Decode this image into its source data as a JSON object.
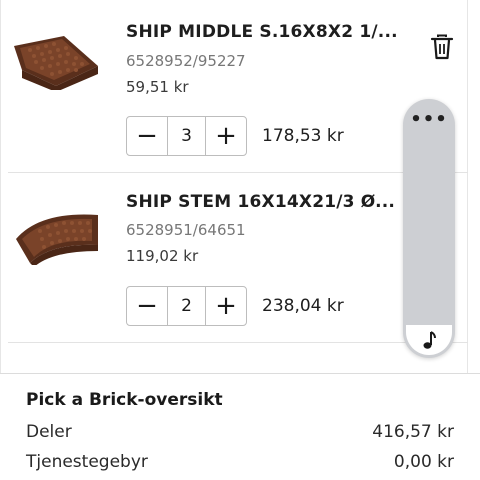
{
  "cart": {
    "items": [
      {
        "name": "SHIP MIDDLE S.16X8X2 1/...",
        "sku": "6528952/95227",
        "unit_price": "59,51 kr",
        "quantity": "3",
        "line_total": "178,53 kr",
        "decrement_label": "−",
        "increment_label": "+"
      },
      {
        "name": "SHIP STEM 16X14X21/3 Ø...",
        "sku": "6528951/64651",
        "unit_price": "119,02 kr",
        "quantity": "2",
        "line_total": "238,04 kr",
        "decrement_label": "−",
        "increment_label": "+"
      }
    ],
    "remove_icon": "trash-icon"
  },
  "floating_panel": {
    "more_label": "•••",
    "music_icon": "music-note-icon"
  },
  "summary": {
    "title": "Pick a Brick-oversikt",
    "rows": [
      {
        "label": "Deler",
        "value": "416,57 kr"
      },
      {
        "label": "Tjenestegebyr",
        "value": "0,00 kr"
      }
    ]
  },
  "colors": {
    "brick_brown": "#6b3a24",
    "panel_gray": "#cdcfd3",
    "divider": "#e3e3e3"
  }
}
